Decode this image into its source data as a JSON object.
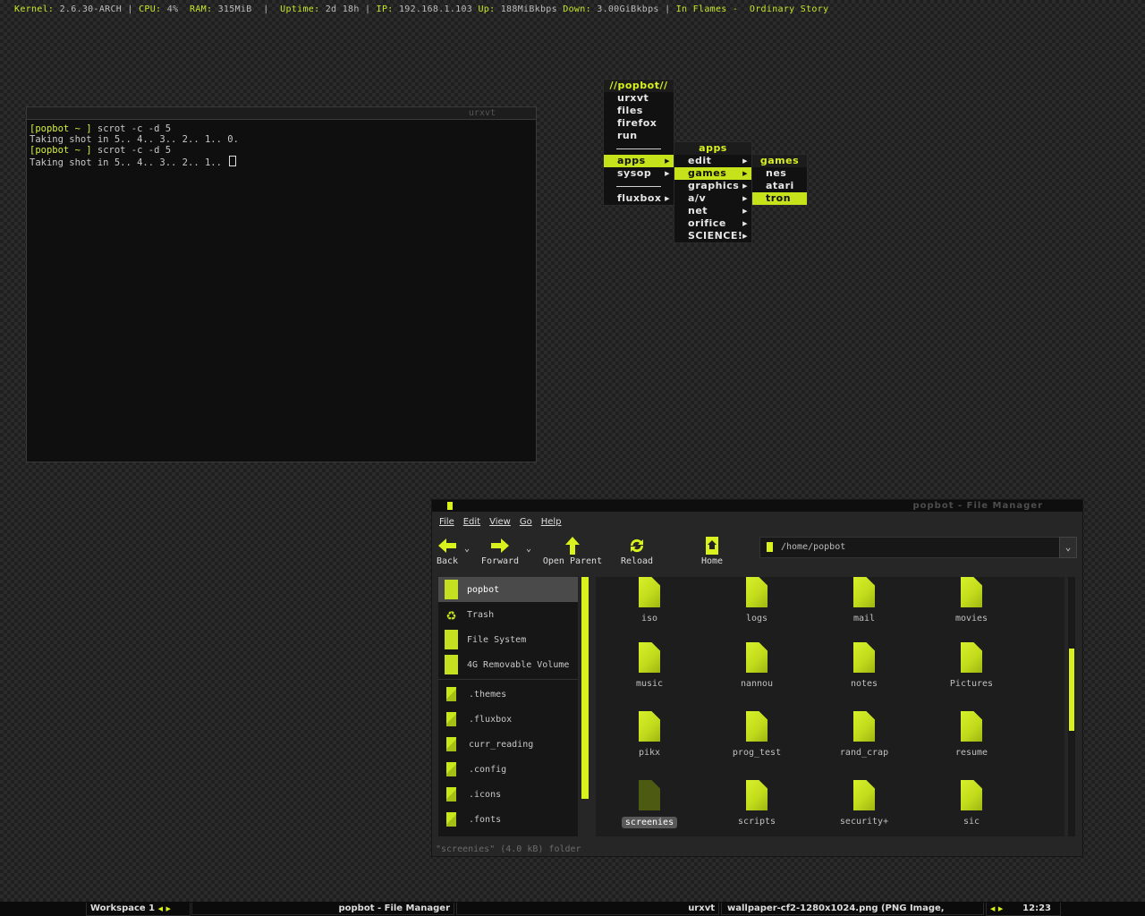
{
  "topbar": {
    "kernel_lbl": "Kernel: ",
    "kernel_val": "2.6.30-ARCH",
    "cpu_lbl": "CPU: ",
    "cpu_val": "4%",
    "ram_lbl": "RAM: ",
    "ram_val": "315MiB",
    "uptime_lbl": "Uptime: ",
    "uptime_val": "2d 18h",
    "ip_lbl": "IP: ",
    "ip_val": "192.168.1.103",
    "up_lbl": "Up: ",
    "up_val": "188MiBkbps",
    "down_lbl": "Down: ",
    "down_val": "3.00GiBkbps",
    "np_artist": "In Flames - ",
    "np_track": "Ordinary Story"
  },
  "terminal": {
    "title": "urxvt",
    "lines": [
      {
        "prompt": "[popbot ~ ]",
        "text": " scrot -c -d 5"
      },
      {
        "prompt": "",
        "text": "Taking shot in 5.. 4.. 3.. 2.. 1.. 0."
      },
      {
        "prompt": "[popbot ~ ]",
        "text": " scrot -c -d 5"
      },
      {
        "prompt": "",
        "text": "Taking shot in 5.. 4.. 3.. 2.. 1.. "
      }
    ]
  },
  "menus": {
    "root": {
      "title": "//popbot//",
      "items": [
        "urxvt",
        "files",
        "firefox",
        "run",
        "",
        "apps",
        "sysop",
        "",
        "fluxbox"
      ]
    },
    "apps": {
      "title": "apps",
      "items": [
        "edit",
        "games",
        "graphics",
        "a/v",
        "net",
        "orifice",
        "SCIENCE!"
      ]
    },
    "games": {
      "title": "games",
      "items": [
        "nes",
        "atari",
        "tron"
      ]
    }
  },
  "filemanager": {
    "title": "popbot - File Manager",
    "menubar": [
      "File",
      "Edit",
      "View",
      "Go",
      "Help"
    ],
    "toolbar": {
      "back": "Back",
      "forward": "Forward",
      "open_parent": "Open Parent",
      "reload": "Reload",
      "home": "Home"
    },
    "address": "/home/popbot",
    "sidebar_places": [
      "popbot",
      "Trash",
      "File System",
      "4G Removable Volume"
    ],
    "sidebar_bookmarks": [
      ".themes",
      ".fluxbox",
      "curr_reading",
      ".config",
      ".icons",
      ".fonts"
    ],
    "folders": [
      "iso",
      "logs",
      "mail",
      "movies",
      "music",
      "nannou",
      "notes",
      "Pictures",
      "pikx",
      "prog_test",
      "rand_crap",
      "resume",
      "screenies",
      "scripts",
      "security+",
      "sic"
    ],
    "status": "\"screenies\" (4.0 kB) folder"
  },
  "taskbar": {
    "workspace": "Workspace 1",
    "task1": "popbot - File Manager",
    "task2": "urxvt",
    "task3": "wallpaper-cf2-1280x1024.png (PNG Image,",
    "clock": "12:23"
  },
  "colors": {
    "accent": "#d9f21d",
    "background": "#2b2b2b",
    "menu_bg": "#111111"
  }
}
